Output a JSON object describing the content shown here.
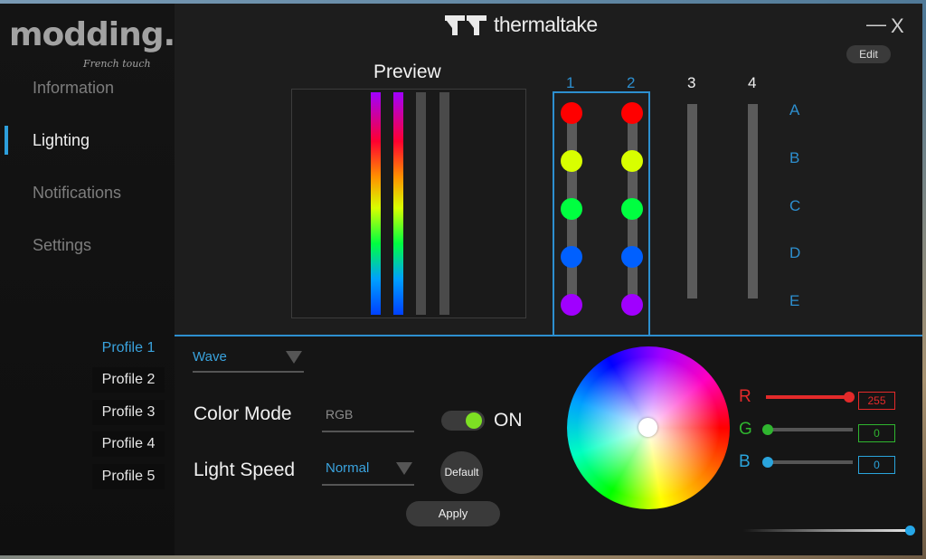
{
  "watermark": {
    "logo": "modding.fr",
    "tagline": "French touch"
  },
  "brand": {
    "name": "thermaltake",
    "icon": "tt-logo-icon"
  },
  "window_controls": {
    "minimize": "—",
    "close": "X"
  },
  "header": {
    "edit_label": "Edit"
  },
  "nav": {
    "items": [
      {
        "label": "Information",
        "active": false
      },
      {
        "label": "Lighting",
        "active": true
      },
      {
        "label": "Notifications",
        "active": false
      },
      {
        "label": "Settings",
        "active": false
      }
    ]
  },
  "profiles": [
    "Profile 1",
    "Profile 2",
    "Profile 3",
    "Profile 4",
    "Profile 5"
  ],
  "active_profile": "Profile 1",
  "preview": {
    "title": "Preview",
    "strips": [
      "rainbow",
      "rainbow",
      "off",
      "off"
    ]
  },
  "channels": {
    "labels": [
      "1",
      "2",
      "3",
      "4"
    ],
    "selected": [
      "1",
      "2"
    ],
    "rows": [
      "A",
      "B",
      "C",
      "D",
      "E"
    ],
    "led_colors": [
      "#ff0000",
      "#d8ff00",
      "#00ff40",
      "#0060ff",
      "#a000ff"
    ]
  },
  "controls": {
    "effect": "Wave",
    "color_mode_label": "Color Mode",
    "color_mode_value": "RGB",
    "toggle_label": "ON",
    "toggle_on": true,
    "light_speed_label": "Light Speed",
    "light_speed_value": "Normal",
    "default_label": "Default",
    "apply_label": "Apply"
  },
  "rgb": {
    "r": {
      "label": "R",
      "value": "255",
      "level": 1.0,
      "color": "#e32a2a"
    },
    "g": {
      "label": "G",
      "value": "0",
      "level": 0.0,
      "color": "#2fb52f"
    },
    "b": {
      "label": "B",
      "value": "0",
      "level": 0.0,
      "color": "#2aa4dc"
    }
  },
  "brightness_level": 1.0,
  "accent_color": "#2d8fcf"
}
